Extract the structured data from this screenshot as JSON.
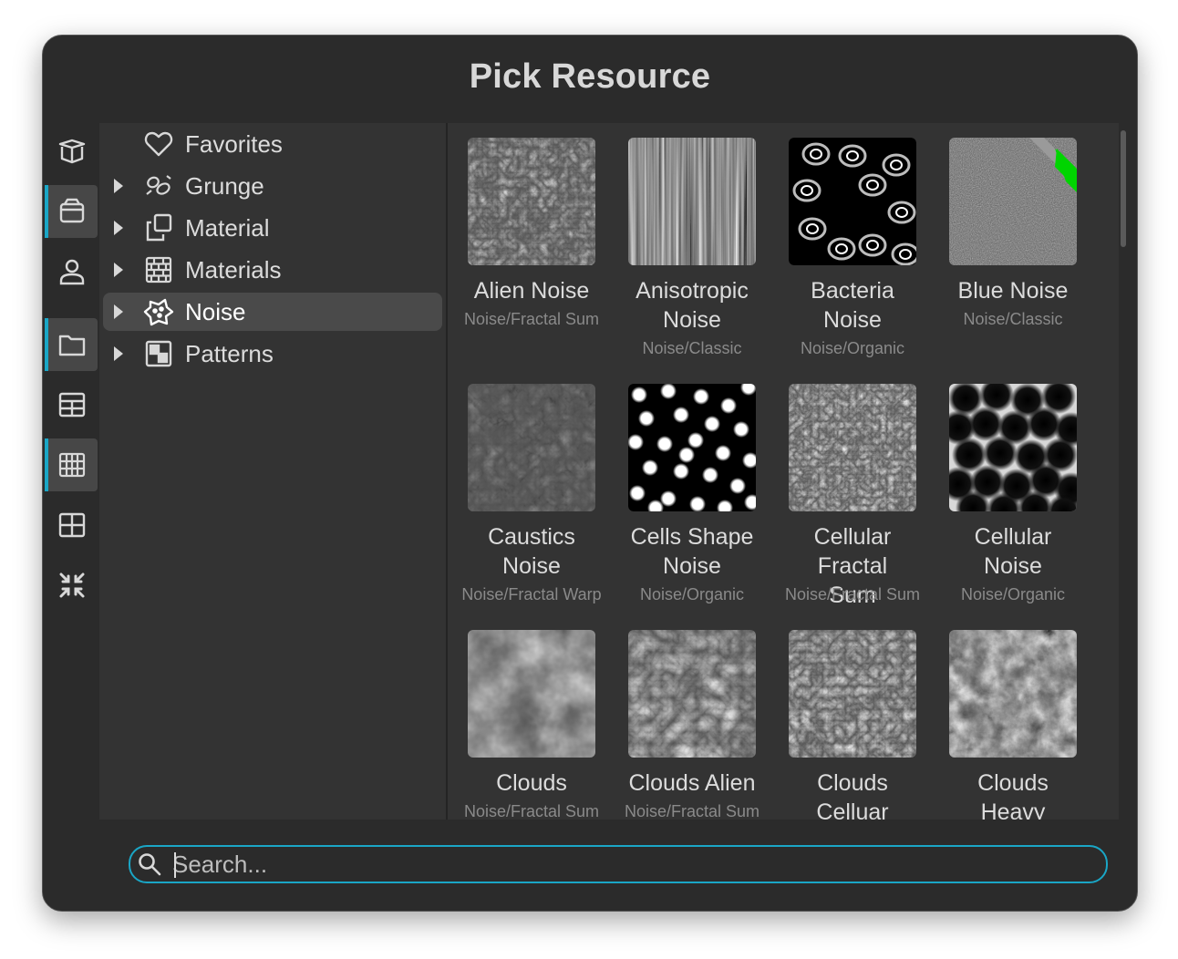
{
  "window": {
    "title": "Pick Resource"
  },
  "sidebar_icons": [
    {
      "name": "box-open-icon",
      "active": false
    },
    {
      "name": "package-icon",
      "active": true
    },
    {
      "name": "user-icon",
      "active": false
    },
    {
      "name": "folder-icon",
      "active": true
    },
    {
      "name": "table-icon",
      "active": false
    },
    {
      "name": "grid-small-icon",
      "active": true
    },
    {
      "name": "grid-large-icon",
      "active": false
    },
    {
      "name": "collapse-icon",
      "active": false
    }
  ],
  "tree": {
    "items": [
      {
        "label": "Favorites",
        "icon": "heart-icon",
        "expandable": false,
        "selected": false
      },
      {
        "label": "Grunge",
        "icon": "grunge-icon",
        "expandable": true,
        "selected": false
      },
      {
        "label": "Material",
        "icon": "copy-icon",
        "expandable": true,
        "selected": false
      },
      {
        "label": "Materials",
        "icon": "brick-icon",
        "expandable": true,
        "selected": false
      },
      {
        "label": "Noise",
        "icon": "noise-icon",
        "expandable": true,
        "selected": true
      },
      {
        "label": "Patterns",
        "icon": "pattern-icon",
        "expandable": true,
        "selected": false
      }
    ]
  },
  "resources": [
    {
      "name": "Alien Noise",
      "category": "Noise/Fractal Sum",
      "texture": "alien"
    },
    {
      "name": "Anisotropic Noise",
      "category": "Noise/Classic",
      "texture": "aniso"
    },
    {
      "name": "Bacteria Noise",
      "category": "Noise/Organic",
      "texture": "bacteria"
    },
    {
      "name": "Blue Noise",
      "category": "Noise/Classic",
      "texture": "blue",
      "flagged": true
    },
    {
      "name": "Caustics Noise",
      "category": "Noise/Fractal Warp",
      "texture": "caustics"
    },
    {
      "name": "Cells Shape Noise",
      "category": "Noise/Organic",
      "texture": "cells"
    },
    {
      "name": "Cellular Fractal Sum",
      "category": "Noise/Fractal Sum",
      "texture": "cellfrac"
    },
    {
      "name": "Cellular Noise",
      "category": "Noise/Organic",
      "texture": "cellular"
    },
    {
      "name": "Clouds",
      "category": "Noise/Fractal Sum",
      "texture": "clouds"
    },
    {
      "name": "Clouds Alien",
      "category": "Noise/Fractal Sum",
      "texture": "cloudsalien"
    },
    {
      "name": "Clouds Celluar",
      "category": "",
      "texture": "cloudscell"
    },
    {
      "name": "Clouds Heavy",
      "category": "",
      "texture": "cloudsheavy"
    }
  ],
  "search": {
    "placeholder": "Search..."
  },
  "colors": {
    "accent": "#1aa6c6",
    "flag": "#00d400"
  }
}
